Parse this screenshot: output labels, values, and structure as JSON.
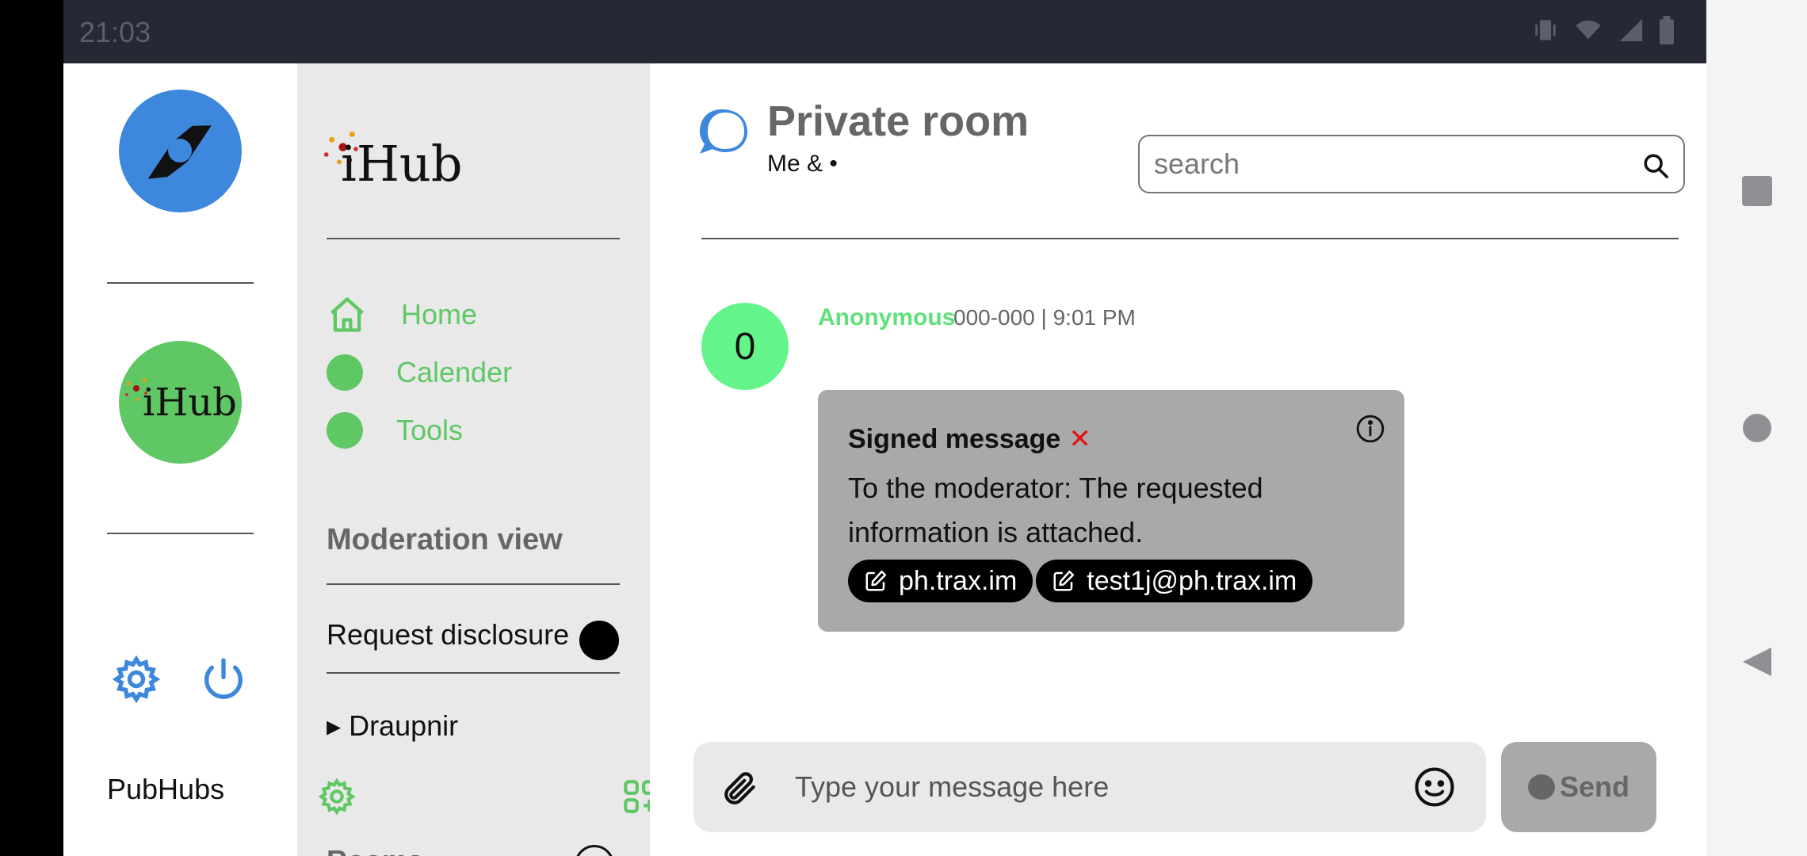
{
  "status": {
    "time": "21:03"
  },
  "rail": {
    "app_name": "PubHubs",
    "hub_logo_text": "iHub"
  },
  "sidebar": {
    "logo_text": "iHub",
    "items": [
      {
        "label": "Home",
        "icon": "home-icon"
      },
      {
        "label": "Calender",
        "icon": "dot"
      },
      {
        "label": "Tools",
        "icon": "dot"
      }
    ],
    "section_title": "Moderation view",
    "request_label": "Request disclosure",
    "group_label": "▸ Draupnir",
    "cut_label": "Rooms"
  },
  "main": {
    "room_title": "Private room",
    "room_subtitle": "Me & •",
    "search_placeholder": "search",
    "message": {
      "avatar": "0",
      "sender": "Anonymous",
      "meta": "000-000  |  9:01 PM",
      "signed_label": "Signed message",
      "signed_mark": "✕",
      "text": "To the moderator: The requested information is attached.",
      "chips": [
        "ph.trax.im",
        "test1j@ph.trax.im"
      ]
    },
    "composer_placeholder": "Type your message here",
    "send_label": "Send"
  },
  "colors": {
    "green": "#5fc864",
    "blue": "#3d87dc",
    "bubble": "#a9a9a9",
    "avatar": "#64f58a"
  }
}
